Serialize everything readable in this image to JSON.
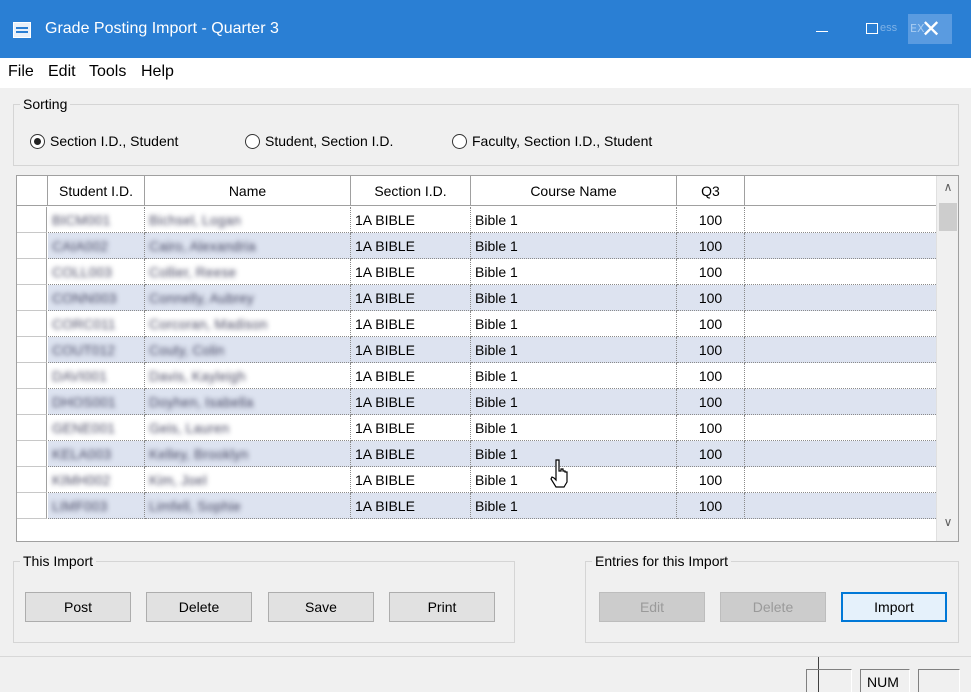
{
  "window": {
    "title": "Grade Posting Import - Quarter 3",
    "ghost_text_max": "ess",
    "ghost_text_close": "EX"
  },
  "menu": [
    "File",
    "Edit",
    "Tools",
    "Help"
  ],
  "sorting": {
    "label": "Sorting",
    "options": [
      {
        "label": "Section I.D., Student",
        "selected": true
      },
      {
        "label": "Student, Section I.D.",
        "selected": false
      },
      {
        "label": "Faculty, Section I.D., Student",
        "selected": false
      }
    ]
  },
  "grid": {
    "columns": [
      "Student I.D.",
      "Name",
      "Section I.D.",
      "Course Name",
      "Q3"
    ],
    "rows": [
      {
        "student_id": "BICM001",
        "name": "Bichsel, Logan",
        "section": "1A BIBLE",
        "course": "Bible 1",
        "q3": "100"
      },
      {
        "student_id": "CAIA002",
        "name": "Cairo, Alexandria",
        "section": "1A BIBLE",
        "course": "Bible 1",
        "q3": "100"
      },
      {
        "student_id": "COLL003",
        "name": "Collier, Reese",
        "section": "1A BIBLE",
        "course": "Bible 1",
        "q3": "100"
      },
      {
        "student_id": "CONN003",
        "name": "Connelly, Aubrey",
        "section": "1A BIBLE",
        "course": "Bible 1",
        "q3": "100"
      },
      {
        "student_id": "CORC011",
        "name": "Corcoran, Madison",
        "section": "1A BIBLE",
        "course": "Bible 1",
        "q3": "100"
      },
      {
        "student_id": "COUT012",
        "name": "Couty, Colin",
        "section": "1A BIBLE",
        "course": "Bible 1",
        "q3": "100"
      },
      {
        "student_id": "DAVI001",
        "name": "Davis, Kayleigh",
        "section": "1A BIBLE",
        "course": "Bible 1",
        "q3": "100"
      },
      {
        "student_id": "DHOS001",
        "name": "Doyhen, Isabella",
        "section": "1A BIBLE",
        "course": "Bible 1",
        "q3": "100"
      },
      {
        "student_id": "GENE001",
        "name": "Geis, Lauren",
        "section": "1A BIBLE",
        "course": "Bible 1",
        "q3": "100"
      },
      {
        "student_id": "KELA003",
        "name": "Kelley, Brooklyn",
        "section": "1A BIBLE",
        "course": "Bible 1",
        "q3": "100"
      },
      {
        "student_id": "KIMH002",
        "name": "Kim, Joel",
        "section": "1A BIBLE",
        "course": "Bible 1",
        "q3": "100"
      },
      {
        "student_id": "LIMF003",
        "name": "Limfell, Sophie",
        "section": "1A BIBLE",
        "course": "Bible 1",
        "q3": "100"
      }
    ]
  },
  "this_import": {
    "label": "This Import",
    "buttons": {
      "post": "Post",
      "delete": "Delete",
      "save": "Save",
      "print": "Print"
    }
  },
  "entries": {
    "label": "Entries for this Import",
    "buttons": {
      "edit": "Edit",
      "delete": "Delete",
      "import": "Import"
    }
  },
  "status": {
    "num": "NUM"
  }
}
